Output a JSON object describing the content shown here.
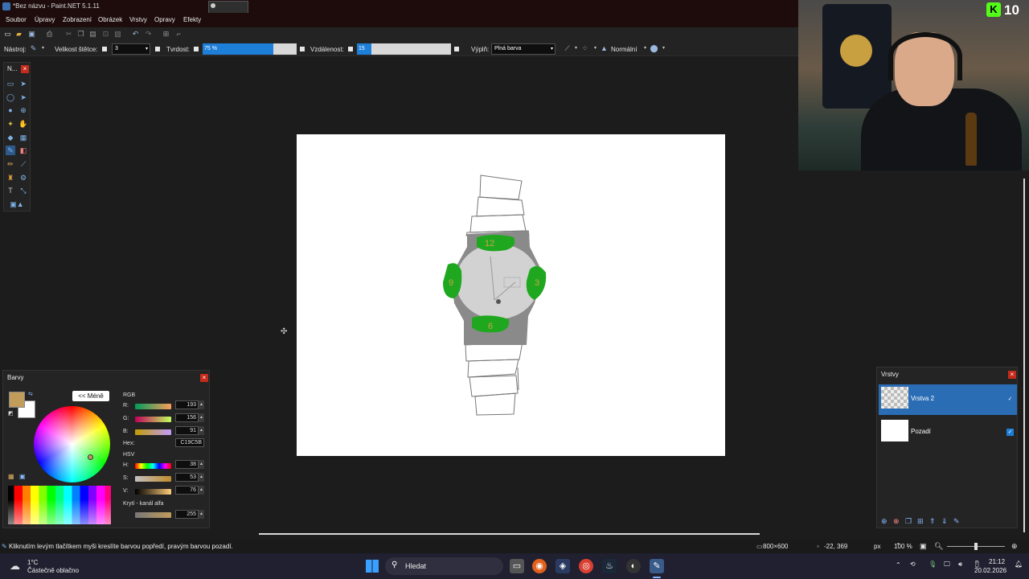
{
  "window": {
    "title": "*Bez názvu - Paint.NET 5.1.11"
  },
  "menu": [
    "Soubor",
    "Úpravy",
    "Zobrazení",
    "Obrázek",
    "Vrstvy",
    "Opravy",
    "Efekty"
  ],
  "toolbar": {
    "tool_label": "Nástroj:",
    "brush_size_label": "Velikost štětce:",
    "brush_size_value": "3",
    "hardness_label": "Tvrdost:",
    "hardness_value": "75 %",
    "hardness_fraction": 0.75,
    "spacing_label": "Vzdálenost:",
    "spacing_value": "15 %",
    "spacing_fraction": 0.15,
    "fill_label": "Výplň:",
    "fill_value": "Plná barva",
    "blend_mode": "Normální"
  },
  "tools_panel": {
    "title": "N..."
  },
  "colors_panel": {
    "title": "Barvy",
    "less_button": "<< Méně",
    "rgb_label": "RGB",
    "r_label": "R:",
    "r_value": "193",
    "g_label": "G:",
    "g_value": "156",
    "b_label": "B:",
    "b_value": "91",
    "hex_label": "Hex:",
    "hex_value": "C19C5B",
    "hsv_label": "HSV",
    "h_label": "H:",
    "h_value": "38",
    "s_label": "S:",
    "s_value": "53",
    "v_label": "V:",
    "v_value": "76",
    "alpha_label": "Krytí - kanál alfa",
    "alpha_value": "255",
    "primary_color": "#C19C5B"
  },
  "layers_panel": {
    "title": "Vrstvy",
    "layers": [
      {
        "name": "Vrstva 2",
        "selected": true
      },
      {
        "name": "Pozadí",
        "selected": false
      }
    ]
  },
  "status": {
    "hint": "Kliknutím levým tlačítkem myši kreslíte barvou popředí, pravým barvou pozadí.",
    "image_size": "800×600",
    "cursor_pos": "-22, 369",
    "units": "px",
    "zoom": "100 %"
  },
  "taskbar": {
    "weather_temp": "1°C",
    "weather_desc": "Částečně oblačno",
    "search_placeholder": "Hledat",
    "time": "21:12",
    "date": "20.02.2026"
  },
  "webcam": {
    "overlay_badge": "10"
  }
}
